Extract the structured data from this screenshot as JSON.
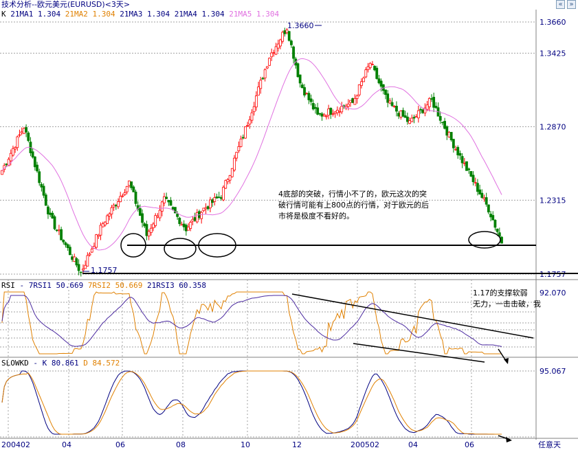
{
  "title": "技术分析--欧元美元(EURUSD)<3天>",
  "nav": {
    "prev_icon": "double-left-arrow-icon",
    "next_icon": "double-right-arrow-icon"
  },
  "main_panel": {
    "legend": [
      {
        "label": "K",
        "color": "#000000"
      },
      {
        "label": "21MA1",
        "color": "#000080"
      },
      {
        "label": "1.304",
        "color": "#000080"
      },
      {
        "label": "21MA2",
        "color": "#e08000"
      },
      {
        "label": "1.304",
        "color": "#e08000"
      },
      {
        "label": "21MA3",
        "color": "#000080"
      },
      {
        "label": "1.304",
        "color": "#000080"
      },
      {
        "label": "21MA4",
        "color": "#000080"
      },
      {
        "label": "1.304",
        "color": "#000080"
      },
      {
        "label": "21MA5",
        "color": "#e070e0"
      },
      {
        "label": "1.304",
        "color": "#e070e0"
      }
    ],
    "y_ticks": [
      "1.3660",
      "1.3425",
      "1.2870",
      "1.2315",
      "1.1757"
    ],
    "high_label": "1.3660",
    "low_label": "1.1757",
    "annotation": "4底部的突破，行情小不了的，欧元这次的突破行情可能有上800点的行情，对于欧元的后市将是极度不看好的。"
  },
  "rsi_panel": {
    "legend": [
      {
        "label": "RSI",
        "color": "#000000"
      },
      {
        "label": "- 7RSI1",
        "color": "#000080"
      },
      {
        "label": "50.669",
        "color": "#000080"
      },
      {
        "label": "7RSI2",
        "color": "#e08000"
      },
      {
        "label": "50.669",
        "color": "#e08000"
      },
      {
        "label": "21RSI3",
        "color": "#000080"
      },
      {
        "label": "60.358",
        "color": "#000080"
      }
    ],
    "y_tick": "92.070",
    "annotation": "1.17的支撑软弱无力，一击击破，我"
  },
  "kd_panel": {
    "legend": [
      {
        "label": "SLOWKD",
        "color": "#000000"
      },
      {
        "label": "- K",
        "color": "#000080"
      },
      {
        "label": "80.861",
        "color": "#000080"
      },
      {
        "label": "D",
        "color": "#e08000"
      },
      {
        "label": "84.572",
        "color": "#e08000"
      }
    ],
    "y_tick": "95.067"
  },
  "x_ticks": [
    "200402",
    "04",
    "06",
    "08",
    "10",
    "12",
    "200502",
    "04",
    "06"
  ],
  "corner_label": "任意天",
  "colors": {
    "up": "#ff0000",
    "down": "#008000",
    "ma": "#e070e0",
    "grid": "#a0a0a0",
    "axis_text": "#000080"
  },
  "chart_data": [
    {
      "type": "candlestick",
      "title": "技术分析--欧元美元(EURUSD)<3天>",
      "x_ticks": [
        "200402",
        "04",
        "06",
        "08",
        "10",
        "12",
        "200502",
        "04",
        "06"
      ],
      "ylim": [
        1.1757,
        1.366
      ],
      "y_ticks": [
        1.366,
        1.3425,
        1.287,
        1.2315,
        1.1757
      ],
      "anchors": [
        [
          0,
          1.254
        ],
        [
          10,
          1.287
        ],
        [
          22,
          1.218
        ],
        [
          36,
          1.177
        ],
        [
          46,
          1.214
        ],
        [
          58,
          1.245
        ],
        [
          66,
          1.205
        ],
        [
          74,
          1.232
        ],
        [
          84,
          1.21
        ],
        [
          92,
          1.225
        ],
        [
          100,
          1.235
        ],
        [
          110,
          1.28
        ],
        [
          122,
          1.34
        ],
        [
          130,
          1.362
        ],
        [
          136,
          1.32
        ],
        [
          144,
          1.295
        ],
        [
          152,
          1.3
        ],
        [
          160,
          1.305
        ],
        [
          168,
          1.335
        ],
        [
          176,
          1.305
        ],
        [
          186,
          1.29
        ],
        [
          196,
          1.307
        ],
        [
          204,
          1.28
        ],
        [
          212,
          1.255
        ],
        [
          222,
          1.225
        ],
        [
          228,
          1.2
        ]
      ],
      "bars": 229,
      "series": [
        {
          "name": "21MA5",
          "period": 21
        }
      ],
      "levels": [
        1.205,
        1.177
      ]
    },
    {
      "type": "line",
      "series": [
        {
          "name": "7RSI1",
          "last": 50.669
        },
        {
          "name": "7RSI2",
          "last": 50.669
        },
        {
          "name": "21RSI3",
          "last": 60.358
        }
      ],
      "y_ticks": [
        92.07
      ]
    },
    {
      "type": "line",
      "series": [
        {
          "name": "K",
          "last": 80.861
        },
        {
          "name": "D",
          "last": 84.572
        }
      ],
      "y_ticks": [
        95.067
      ]
    }
  ]
}
